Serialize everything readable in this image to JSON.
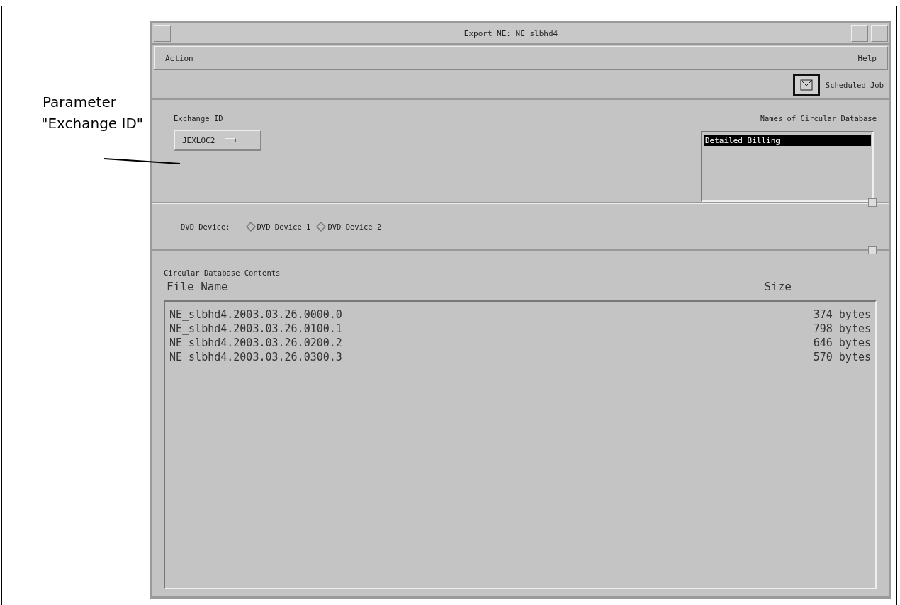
{
  "annotation": {
    "text_lines": [
      "Parameter",
      "\"Exchange ID\""
    ]
  },
  "window": {
    "title": "Export   NE:  NE_slbhd4"
  },
  "menu": [
    "Action",
    "Help"
  ],
  "toolbar": {
    "scheduled_job": "Scheduled Job"
  },
  "exchange_id": {
    "label": "Exchange ID",
    "value": "JEXLOC2"
  },
  "database_names": {
    "label": "Names of Circular Database",
    "items": [
      {
        "text": "Detailed Billing",
        "selected": true
      }
    ]
  },
  "dvd_device": {
    "label": "DVD Device:",
    "options": [
      {
        "label": "DVD Device 1",
        "selected": false
      },
      {
        "label": "DVD Device 2",
        "selected": false
      }
    ]
  },
  "contents": {
    "title": "Circular Database Contents",
    "columns": [
      "File Name",
      "Size"
    ],
    "rows": [
      [
        "NE_slbhd4.2003.03.26.0000.0",
        "374 bytes"
      ],
      [
        "NE_slbhd4.2003.03.26.0100.1",
        "798 bytes"
      ],
      [
        "NE_slbhd4.2003.03.26.0200.2",
        "646 bytes"
      ],
      [
        "NE_slbhd4.2003.03.26.0300.3",
        "570 bytes"
      ]
    ]
  }
}
